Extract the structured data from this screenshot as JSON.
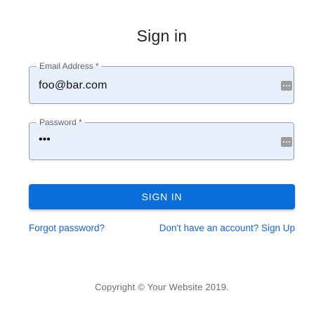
{
  "header": {
    "title": "Sign in"
  },
  "form": {
    "email": {
      "label": "Email Address *",
      "value": "foo@bar.com",
      "icon": "autofill-key-icon"
    },
    "password": {
      "label": "Password *",
      "value": "•••",
      "icon": "autofill-key-icon"
    },
    "submit_label": "SIGN IN"
  },
  "links": {
    "forgot_password": "Forgot password?",
    "sign_up": "Don't have an account? Sign Up"
  },
  "footer": {
    "copyright": "Copyright © Your Website 2019."
  },
  "colors": {
    "primary": "#0a6ed8",
    "link": "#1565c0",
    "autofill_background": "#e8f0fe",
    "field_border": "#9aa0a8"
  }
}
